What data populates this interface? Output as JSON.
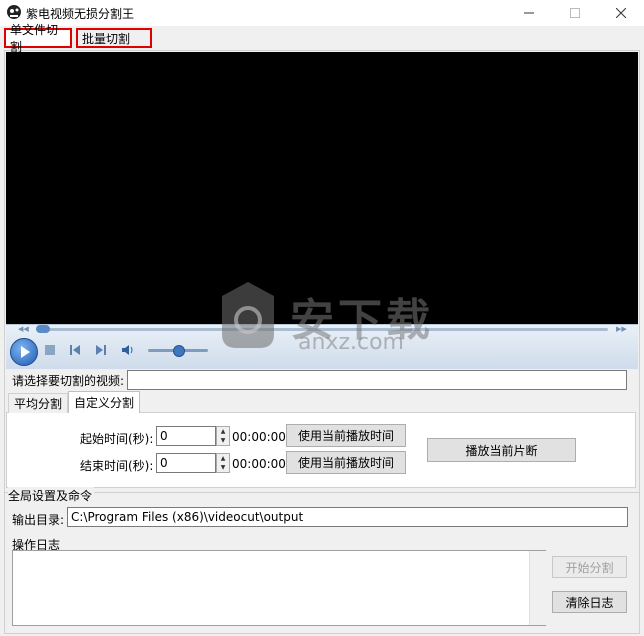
{
  "window": {
    "title": "紫电视频无损分割王"
  },
  "top_tabs": [
    {
      "label": "单文件切割"
    },
    {
      "label": "批量切割"
    }
  ],
  "watermark": {
    "text": "安下载",
    "sub": "anxz.com"
  },
  "video_select": {
    "label": "请选择要切割的视频:",
    "value": ""
  },
  "sub_tabs": [
    {
      "label": "平均分割"
    },
    {
      "label": "自定义分割"
    }
  ],
  "custom": {
    "start_label": "起始时间(秒):",
    "start_value": "0",
    "start_time": "00:00:00",
    "end_label": "结束时间(秒):",
    "end_value": "0",
    "end_time": "00:00:00",
    "use_current_label": "使用当前播放时间",
    "play_segment_label": "播放当前片断"
  },
  "global": {
    "section_label": "全局设置及命令",
    "output_label": "输出目录:",
    "output_value": "C:\\Program Files (x86)\\videocut\\output",
    "log_label": "操作日志",
    "start_split_label": "开始分割",
    "clear_log_label": "清除日志"
  },
  "colors": {
    "highlight": "#e00000",
    "accent": "#1d5cb4"
  }
}
